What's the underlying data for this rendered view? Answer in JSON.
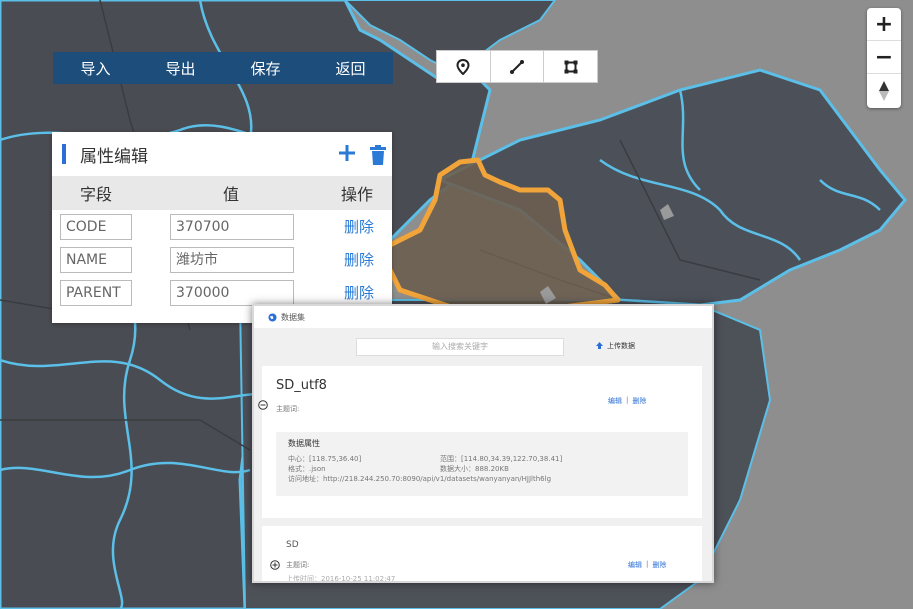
{
  "toolbar": {
    "import": "导入",
    "export": "导出",
    "save": "保存",
    "back": "返回"
  },
  "draw_tools": [
    "point-tool-icon",
    "line-tool-icon",
    "polygon-tool-icon"
  ],
  "zoom": {
    "in": "+",
    "out": "−",
    "compass": "▲"
  },
  "attr_panel": {
    "title": "属性编辑",
    "col_field": "字段",
    "col_value": "值",
    "col_action": "操作",
    "rows": [
      {
        "field": "CODE",
        "value": "370700",
        "action": "删除"
      },
      {
        "field": "NAME",
        "value": "潍坊市",
        "action": "删除"
      },
      {
        "field": "PARENT",
        "value": "370000",
        "action": "删除"
      }
    ]
  },
  "dataset": {
    "title": "数据集",
    "search_placeholder": "输入搜索关键字",
    "upload": "上传数据",
    "items": [
      {
        "name": "SD_utf8",
        "keywords": "主题词:",
        "edit": "编辑",
        "delete": "删除",
        "attr_title": "数据属性",
        "center": "中心：[118.75,36.40]",
        "format": "格式：.json",
        "url": "访问地址：http://218.244.250.70:8090/api/v1/datasets/wanyanyan/HJJlth6lg",
        "extent": "范围：[114.80,34.39,122.70,38.41]",
        "size": "数据大小：888.20KB"
      },
      {
        "name": "SD",
        "keywords": "主题词:",
        "edit": "编辑",
        "delete": "删除",
        "upload_time": "上传时间：2016-10-25 11:02:47"
      }
    ]
  },
  "colors": {
    "nav_bg": "#1d4e7b",
    "boundary": "#5bbfe8",
    "highlight": "#f0a43a",
    "link": "#2b6fd6"
  }
}
